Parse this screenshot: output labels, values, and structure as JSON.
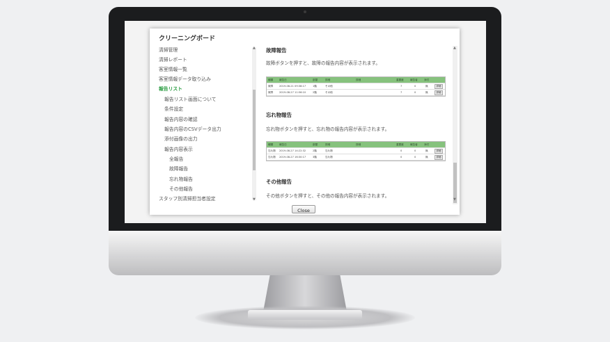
{
  "modal": {
    "title": "クリーニングボード",
    "close_label": "Close"
  },
  "nav": {
    "items": [
      {
        "label": "清掃管理",
        "level": 0,
        "active": false
      },
      {
        "label": "清掃レポート",
        "level": 0,
        "active": false
      },
      {
        "label": "客室情報一覧",
        "level": 0,
        "active": false
      },
      {
        "label": "客室情報データ取り込み",
        "level": 0,
        "active": false
      },
      {
        "label": "報告リスト",
        "level": 0,
        "active": true
      },
      {
        "label": "報告リスト画面について",
        "level": 1,
        "active": false
      },
      {
        "label": "条件設定",
        "level": 1,
        "active": false
      },
      {
        "label": "報告内容の確認",
        "level": 1,
        "active": false
      },
      {
        "label": "報告内容のCSVデータ出力",
        "level": 1,
        "active": false
      },
      {
        "label": "添付画像の出力",
        "level": 1,
        "active": false
      },
      {
        "label": "報告内容表示",
        "level": 1,
        "active": false
      },
      {
        "label": "全報告",
        "level": 2,
        "active": false
      },
      {
        "label": "故障報告",
        "level": 2,
        "active": false
      },
      {
        "label": "忘れ物報告",
        "level": 2,
        "active": false
      },
      {
        "label": "その他報告",
        "level": 2,
        "active": false
      },
      {
        "label": "スタッフ別清掃担当者設定",
        "level": 0,
        "active": false
      }
    ]
  },
  "sections": [
    {
      "title": "故障報告",
      "desc": "故障ボタンを押すと、故障の報告内容が表示されます。",
      "table": {
        "headers": [
          "種類",
          "報告日",
          "部屋",
          "詳細",
          "詳細",
          "重要度",
          "報告者",
          "添付"
        ],
        "rows": [
          [
            "故障",
            "2019-08-21 09:38:17",
            "1階",
            "その他",
            "",
            "7",
            "0",
            "無"
          ],
          [
            "故障",
            "2019-08-27 11:56:10",
            "2階",
            "その他",
            "",
            "7",
            "0",
            "無"
          ]
        ],
        "button_label": "詳細"
      }
    },
    {
      "title": "忘れ物報告",
      "desc": "忘れ物ボタンを押すと、忘れ物の報告内容が表示されます。",
      "table": {
        "headers": [
          "種類",
          "報告日",
          "部屋",
          "詳細",
          "詳細",
          "重要度",
          "報告者",
          "添付"
        ],
        "rows": [
          [
            "忘れ物",
            "2019-08-27 14:22:32",
            "2階",
            "忘れ物",
            "",
            "0",
            "0",
            "無"
          ],
          [
            "忘れ物",
            "2019-08-27 16:30:17",
            "3階",
            "忘れ物",
            "",
            "0",
            "0",
            "無"
          ]
        ],
        "button_label": "詳細"
      }
    },
    {
      "title": "その他報告",
      "desc": "その他ボタンを押すと、その他の報告内容が表示されます。"
    }
  ],
  "colors": {
    "active_nav": "#2e9e45",
    "table_header": "#86c27d",
    "bezel": "#1b1c1e"
  },
  "icons": {
    "scroll_up": "up-arrow-icon",
    "scroll_down": "down-arrow-icon"
  }
}
